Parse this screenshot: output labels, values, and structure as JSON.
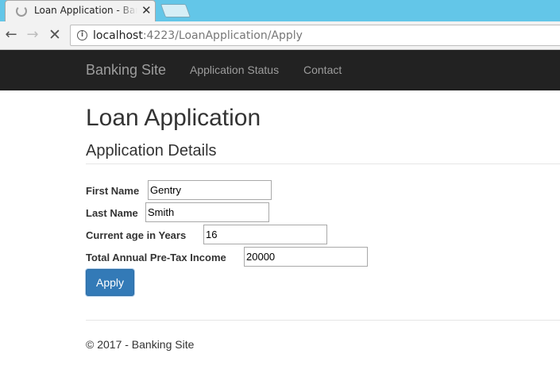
{
  "browser": {
    "tab_title": "Loan Application - Banking Site",
    "close_glyph": "✕",
    "url_host": "localhost",
    "url_rest": ":4223/LoanApplication/Apply",
    "back_glyph": "←",
    "forward_glyph": "→",
    "stop_glyph": "✕",
    "info_glyph": "i"
  },
  "navbar": {
    "brand": "Banking Site",
    "links": [
      "Application Status",
      "Contact"
    ]
  },
  "page": {
    "title": "Loan Application",
    "subtitle": "Application Details"
  },
  "form": {
    "first_name_label": "First Name",
    "first_name_value": "Gentry",
    "last_name_label": "Last Name",
    "last_name_value": "Smith",
    "age_label": "Current age in Years",
    "age_value": "16",
    "income_label": "Total Annual Pre-Tax Income",
    "income_value": "20000",
    "apply_label": "Apply"
  },
  "footer": {
    "text": "© 2017 - Banking Site"
  },
  "colors": {
    "tabstrip": "#63c6e8",
    "navbar": "#222222",
    "primary_button": "#337ab7"
  }
}
